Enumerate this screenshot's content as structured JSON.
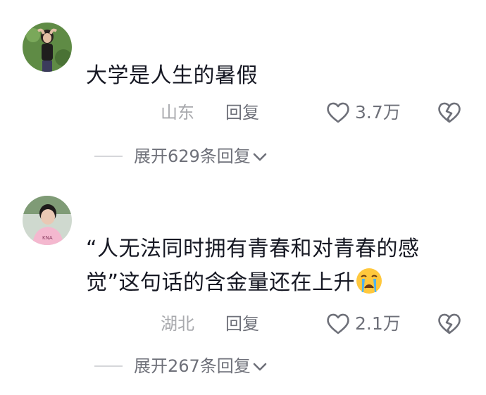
{
  "comments": [
    {
      "avatar_icon": "user-avatar-photo",
      "text": "大学是人生的暑假",
      "region": "山东",
      "reply_label": "回复",
      "like_count": "3.7万",
      "expand_label": "展开629条回复"
    },
    {
      "avatar_icon": "user-avatar-photo",
      "text_line1": "“人无法同时拥有青春和对青春的感",
      "text_line2": "觉”这句话的含金量还在上升",
      "emoji": "crying-emoji",
      "region": "湖北",
      "reply_label": "回复",
      "like_count": "2.1万",
      "expand_label": "展开267条回复"
    }
  ],
  "colors": {
    "text": "#161823",
    "secondary": "#6e7079",
    "muted": "#a8a9ad"
  }
}
